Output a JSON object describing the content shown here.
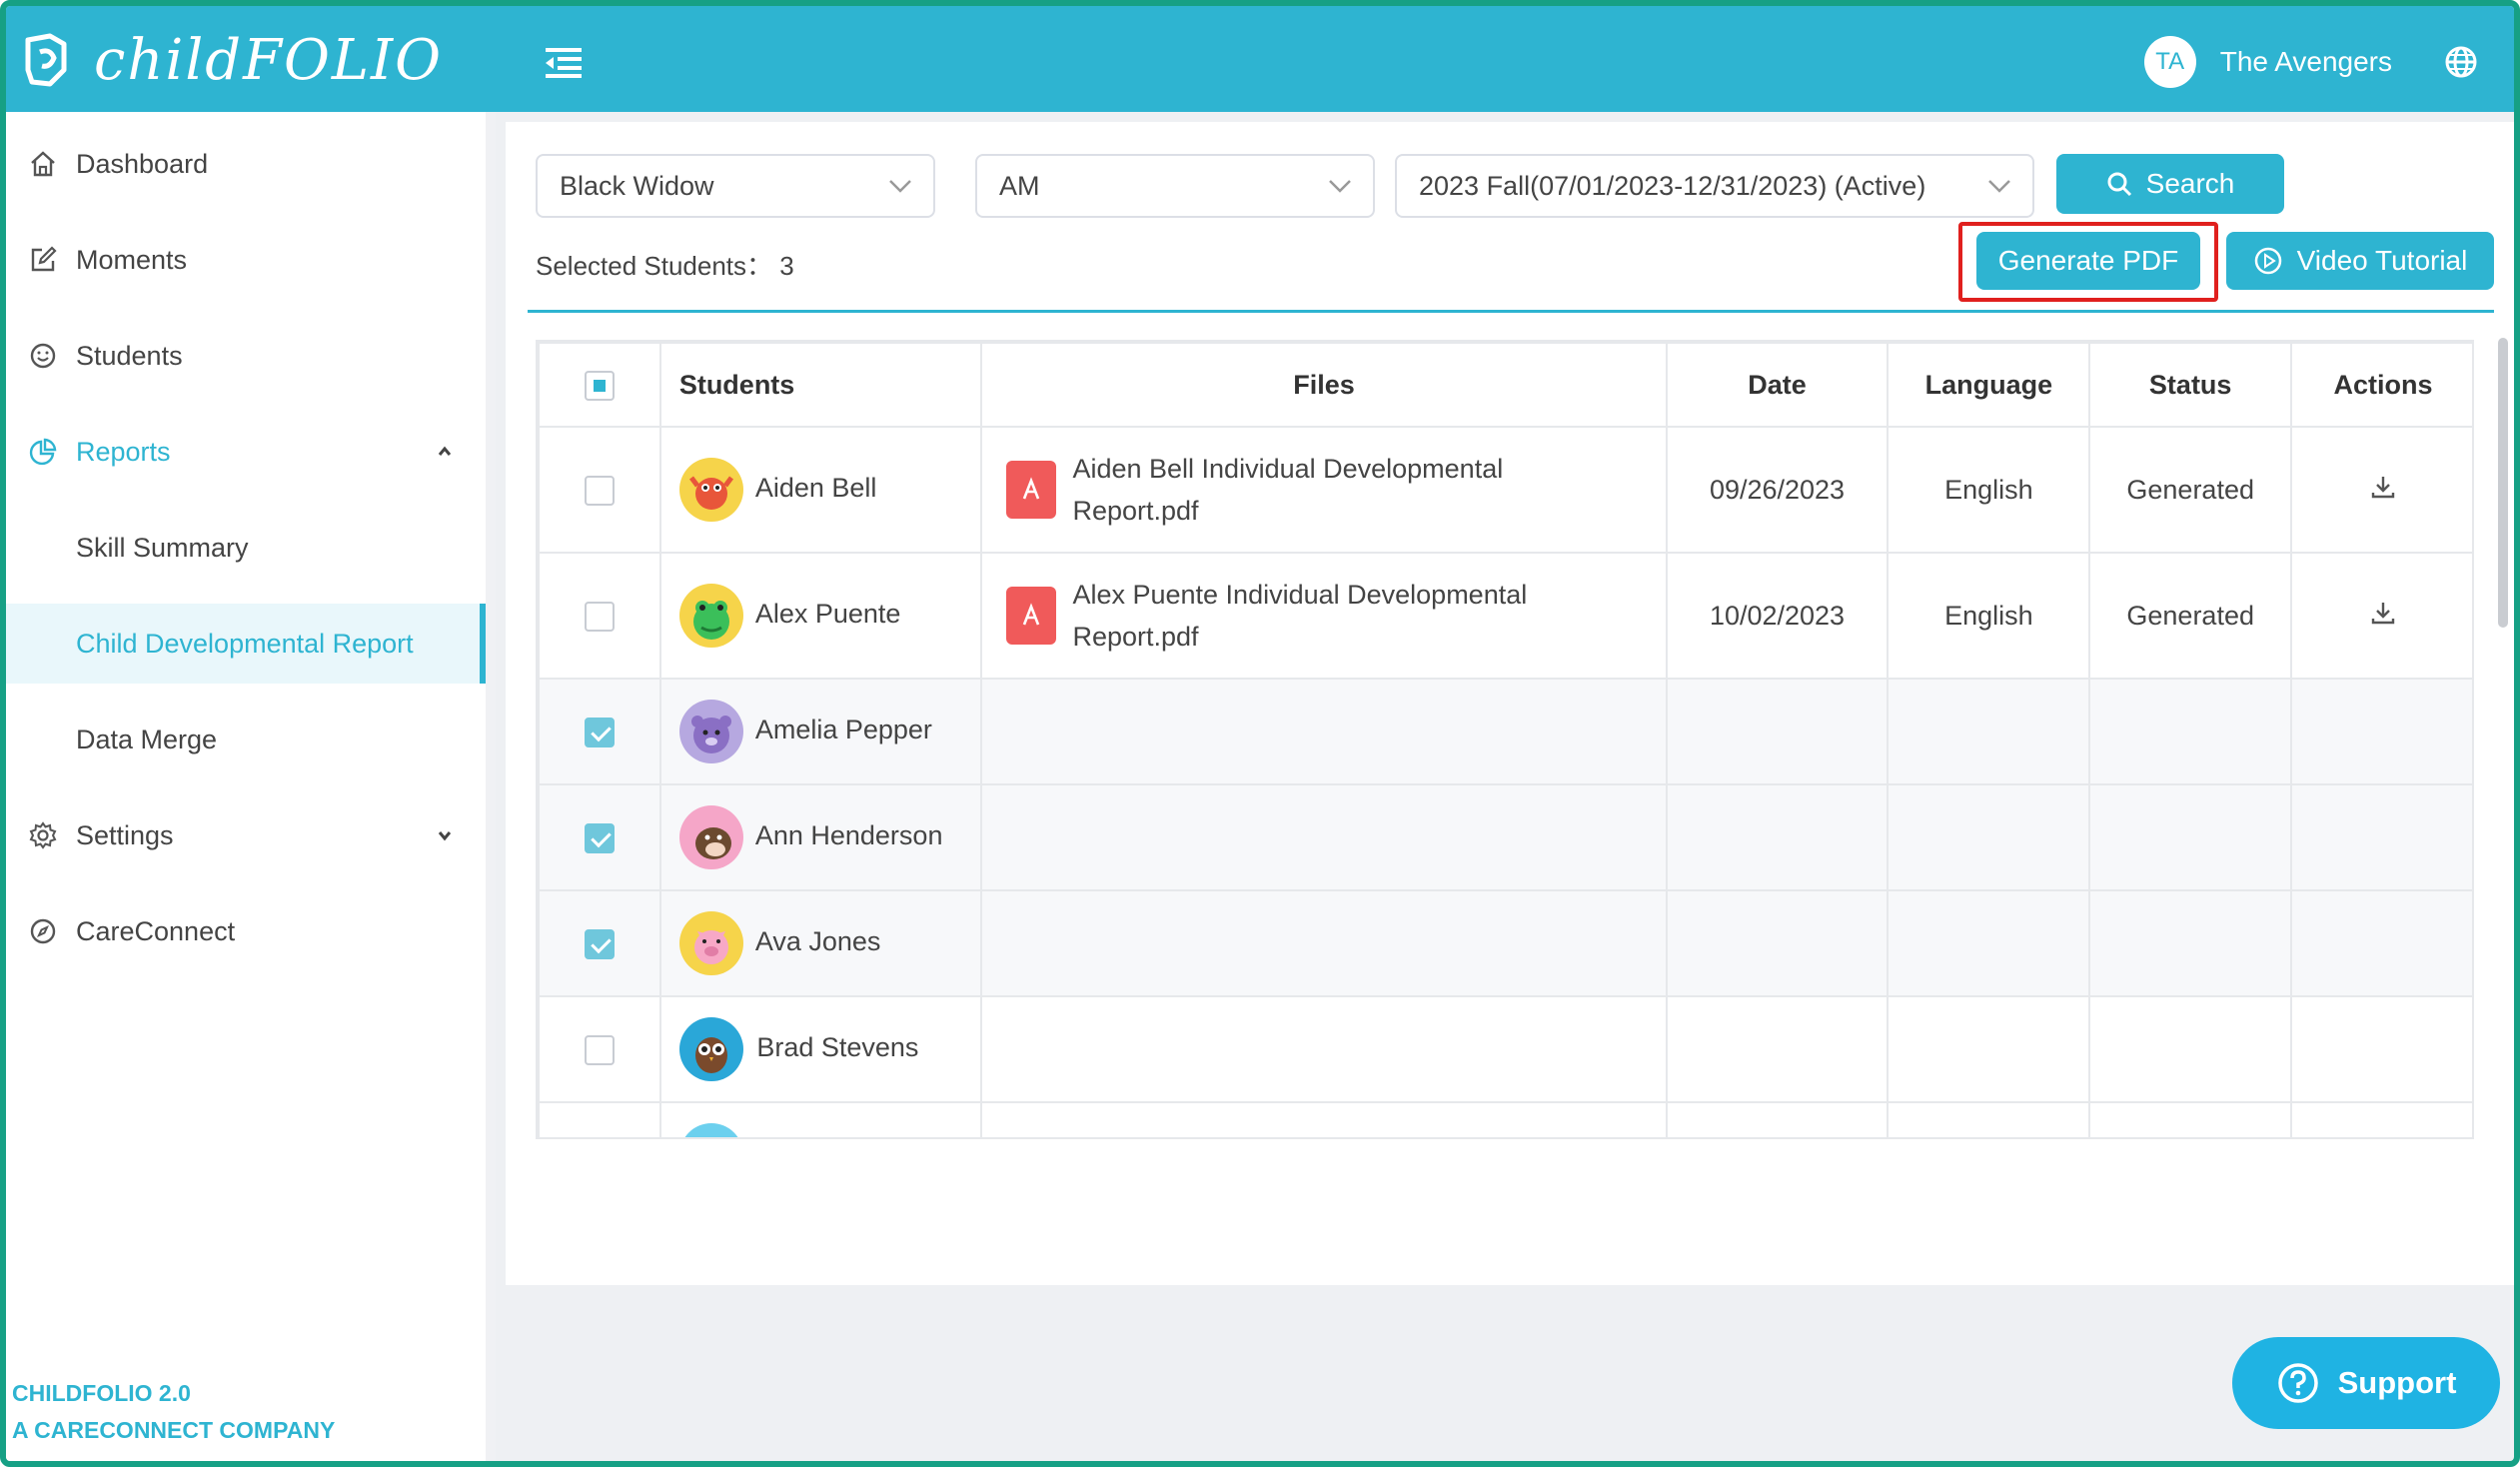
{
  "app": {
    "logo_text": "childFOLIO",
    "user_initials": "TA",
    "user_name": "The Avengers"
  },
  "sidebar": {
    "items": [
      {
        "label": "Dashboard",
        "icon": "home-icon"
      },
      {
        "label": "Moments",
        "icon": "edit-icon"
      },
      {
        "label": "Students",
        "icon": "smile-icon"
      },
      {
        "label": "Reports",
        "icon": "pie-chart-icon"
      },
      {
        "label": "Settings",
        "icon": "gear-icon"
      },
      {
        "label": "CareConnect",
        "icon": "compass-icon"
      }
    ],
    "reports_sub": [
      {
        "label": "Skill Summary"
      },
      {
        "label": "Child Developmental Report"
      },
      {
        "label": "Data Merge"
      }
    ],
    "footer_line1": "CHILDFOLIO 2.0",
    "footer_line2": "A CARECONNECT COMPANY"
  },
  "filters": {
    "teacher": "Black Widow",
    "session": "AM",
    "term": "2023 Fall(07/01/2023-12/31/2023) (Active)",
    "search_label": "Search"
  },
  "toolbar": {
    "selected_label": "Selected Students： 3",
    "generate_pdf": "Generate PDF",
    "video_tutorial": "Video Tutorial"
  },
  "table": {
    "headers": [
      "Students",
      "Files",
      "Date",
      "Language",
      "Status",
      "Actions"
    ],
    "rows": [
      {
        "name": "Aiden Bell",
        "file_line1": "Aiden Bell Individual Developmental",
        "file_line2": "Report.pdf",
        "date": "09/26/2023",
        "language": "English",
        "status": "Generated",
        "checked": false,
        "avatar_color": "#f6d44a"
      },
      {
        "name": "Alex Puente",
        "file_line1": "Alex Puente Individual Developmental",
        "file_line2": "Report.pdf",
        "date": "10/02/2023",
        "language": "English",
        "status": "Generated",
        "checked": false,
        "avatar_color": "#f6d44a"
      },
      {
        "name": "Amelia Pepper",
        "checked": true,
        "avatar_color": "#b6a8e0"
      },
      {
        "name": "Ann Henderson",
        "checked": true,
        "avatar_color": "#f5a6c8"
      },
      {
        "name": "Ava Jones",
        "checked": true,
        "avatar_color": "#f6d44a"
      },
      {
        "name": "Brad Stevens",
        "checked": false,
        "avatar_color": "#2aa7d8"
      }
    ]
  },
  "support": {
    "label": "Support"
  },
  "colors": {
    "brand": "#2eb4d1",
    "highlight": "#e0201e",
    "pdf": "#f05a5a"
  }
}
